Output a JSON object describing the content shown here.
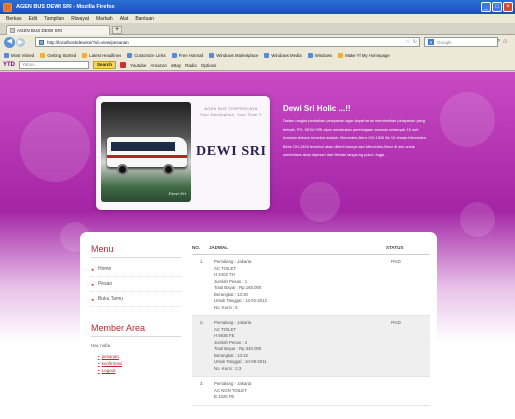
{
  "window": {
    "title": "AGEN BUS DEWI SRI - Mozilla Firefox"
  },
  "menubar": [
    "Berkas",
    "Edit",
    "Tampilan",
    "Riwayat",
    "Markah",
    "Alat",
    "Bantuan"
  ],
  "tab": {
    "label": "AGEN BUS DEWI SRI",
    "new_tab": "+"
  },
  "address": {
    "url": "http://localhost/dewisri/?id=view/pesanan",
    "search_placeholder": "Google"
  },
  "bookmarks": [
    "Most Visited",
    "Getting Started",
    "Latest Headlines",
    "Customize Links",
    "Free Hotmail",
    "Windows Marketplace",
    "Windows Media",
    "Windows",
    "Make Yl My Homepage"
  ],
  "yahoo_toolbar": {
    "brand": "YTD",
    "search_placeholder": "Yahoo",
    "search_button": "Search",
    "items": [
      "Youtube",
      "Amazon",
      "eBay",
      "Radio",
      "Options"
    ]
  },
  "header": {
    "tagline_1": "AGEN BUS TERPERCAYA",
    "tagline_2": "Your Destination, Your Time !!",
    "brand": "DEWI SRI",
    "bus_signature": "Dewi Sri",
    "holic_title": "Dewi Sri Holic ...!!",
    "holic_text": "Dalam rangka perbaikan pelayanan agar dapat terus memberikan pelayanan yang terbaik, PO. DEWI SRI akan melakukan peremajaan armada sebanyak 15 unit. Armada terbaru tersebut adalah; Mercedes-Benz OH-1526 Air 10 chasis Mercedes-Benz OH-1526 tersebut akan dibeli busnya dari Mercedes-Benz di sini untuk sementara akan dipesan dari Medan langsung pulun Jogja."
  },
  "sidebar": {
    "menu_title": "Menu",
    "menu_items": [
      "Home",
      "Pesan",
      "Buku Tamu"
    ],
    "member_title": "Member Area",
    "member_name": "Hai, nofia",
    "member_links": [
      "pesanan",
      "konfirmasi",
      "Logout"
    ]
  },
  "table": {
    "headers": {
      "no": "NO.",
      "jadwal": "JADWAL",
      "status": "STATUS"
    },
    "rows": [
      {
        "no": "1.",
        "lines": [
          "Pemalang - Jakarta",
          "AC TOILET",
          "H 2402 TH",
          "Jumlah Pesan : 1",
          "Total Bayar : Rp.165.000",
          "Berangkat : 13:30",
          "Untuk Tanggal : 14-02-2012",
          "No. Kursi : 5"
        ],
        "status": "PAID"
      },
      {
        "no": "2.",
        "lines": [
          "Pemalang - Jakarta",
          "AC TOILET",
          "H 5935 FE",
          "Jumlah Pesan : 2",
          "Total Bayar : Rp.340.000",
          "Berangkat : 13:15",
          "Untuk Tanggal : 10-08-2011",
          "No. Kursi : 2,3"
        ],
        "status": "PAID"
      },
      {
        "no": "3.",
        "lines": [
          "Pemalang - Jakarta",
          "AC NON TOILET",
          "B 1625 FE"
        ],
        "status": ""
      }
    ]
  }
}
